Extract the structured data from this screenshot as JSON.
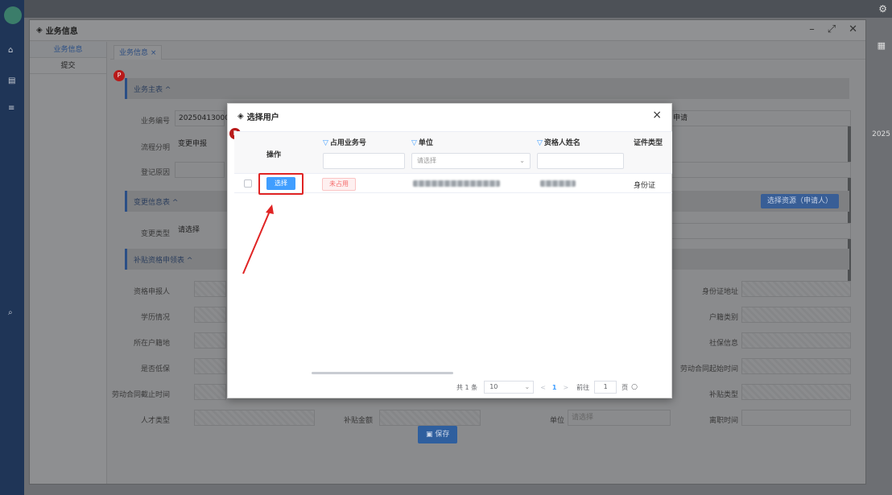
{
  "background": {
    "side_icons": [
      "home-icon",
      "document-icon",
      "list-icon",
      "search-icon"
    ],
    "right_edge_text": "2025"
  },
  "biz_window": {
    "title": "业务信息",
    "sidebar": [
      {
        "label": "业务信息",
        "active": true
      },
      {
        "label": "提交",
        "active": false
      }
    ],
    "tab": {
      "label": "业务信息",
      "close": "×"
    },
    "sections": {
      "main": "业务主表 ^",
      "change": "变更信息表 ^",
      "subsidy": "补贴资格申领表 ^"
    },
    "fields": {
      "business_no": {
        "label": "业务编号",
        "value": "202504130000"
      },
      "process_branch": {
        "label": "流程分明",
        "value": "变更申报"
      },
      "reg_reason": {
        "label": "登记原因",
        "value": ""
      },
      "change_type": {
        "label": "变更类型",
        "value": "请选择"
      },
      "applicant_label": "资格申报人",
      "education_label": "学历情况",
      "residence_label": "所在户籍地",
      "low_income_label": "是否低保",
      "contract_end_label": "劳动合同截止时间",
      "talent_type_label": "人才类型",
      "subsidy_amount_label": "补贴金额",
      "unit_label": "单位",
      "unit_placeholder": "请选择",
      "resign_label": "离职时间",
      "id_address_label": "身份证地址",
      "household_type_label": "户籍类别",
      "social_security_label": "社保信息",
      "contract_start_label": "劳动合同起始时间",
      "subsidy_type_label": "补贴类型",
      "apply_value": "申请"
    },
    "select_resource_button": "选择资源（申请人）",
    "save_button": "保存"
  },
  "modal": {
    "title": "选择用户",
    "close": "×",
    "columns": [
      {
        "label": "操作",
        "filter": false
      },
      {
        "label": "占用业务号",
        "filter": true,
        "input_placeholder": ""
      },
      {
        "label": "单位",
        "filter": true,
        "input_placeholder": "请选择"
      },
      {
        "label": "资格人姓名",
        "filter": true,
        "input_placeholder": ""
      },
      {
        "label": "证件类型",
        "filter": false
      }
    ],
    "rows": [
      {
        "action": "选择",
        "status": "未占用",
        "id_type": "身份证"
      }
    ],
    "pagination": {
      "total": "共 1 条",
      "page_size": "10",
      "prev": "<",
      "current_page": "1",
      "next": ">",
      "goto_label": "前往",
      "goto_value": "1",
      "page_suffix": "页"
    }
  },
  "colors": {
    "accent": "#409eff",
    "highlight": "#e02424",
    "tag_red": "#f56c6c"
  }
}
